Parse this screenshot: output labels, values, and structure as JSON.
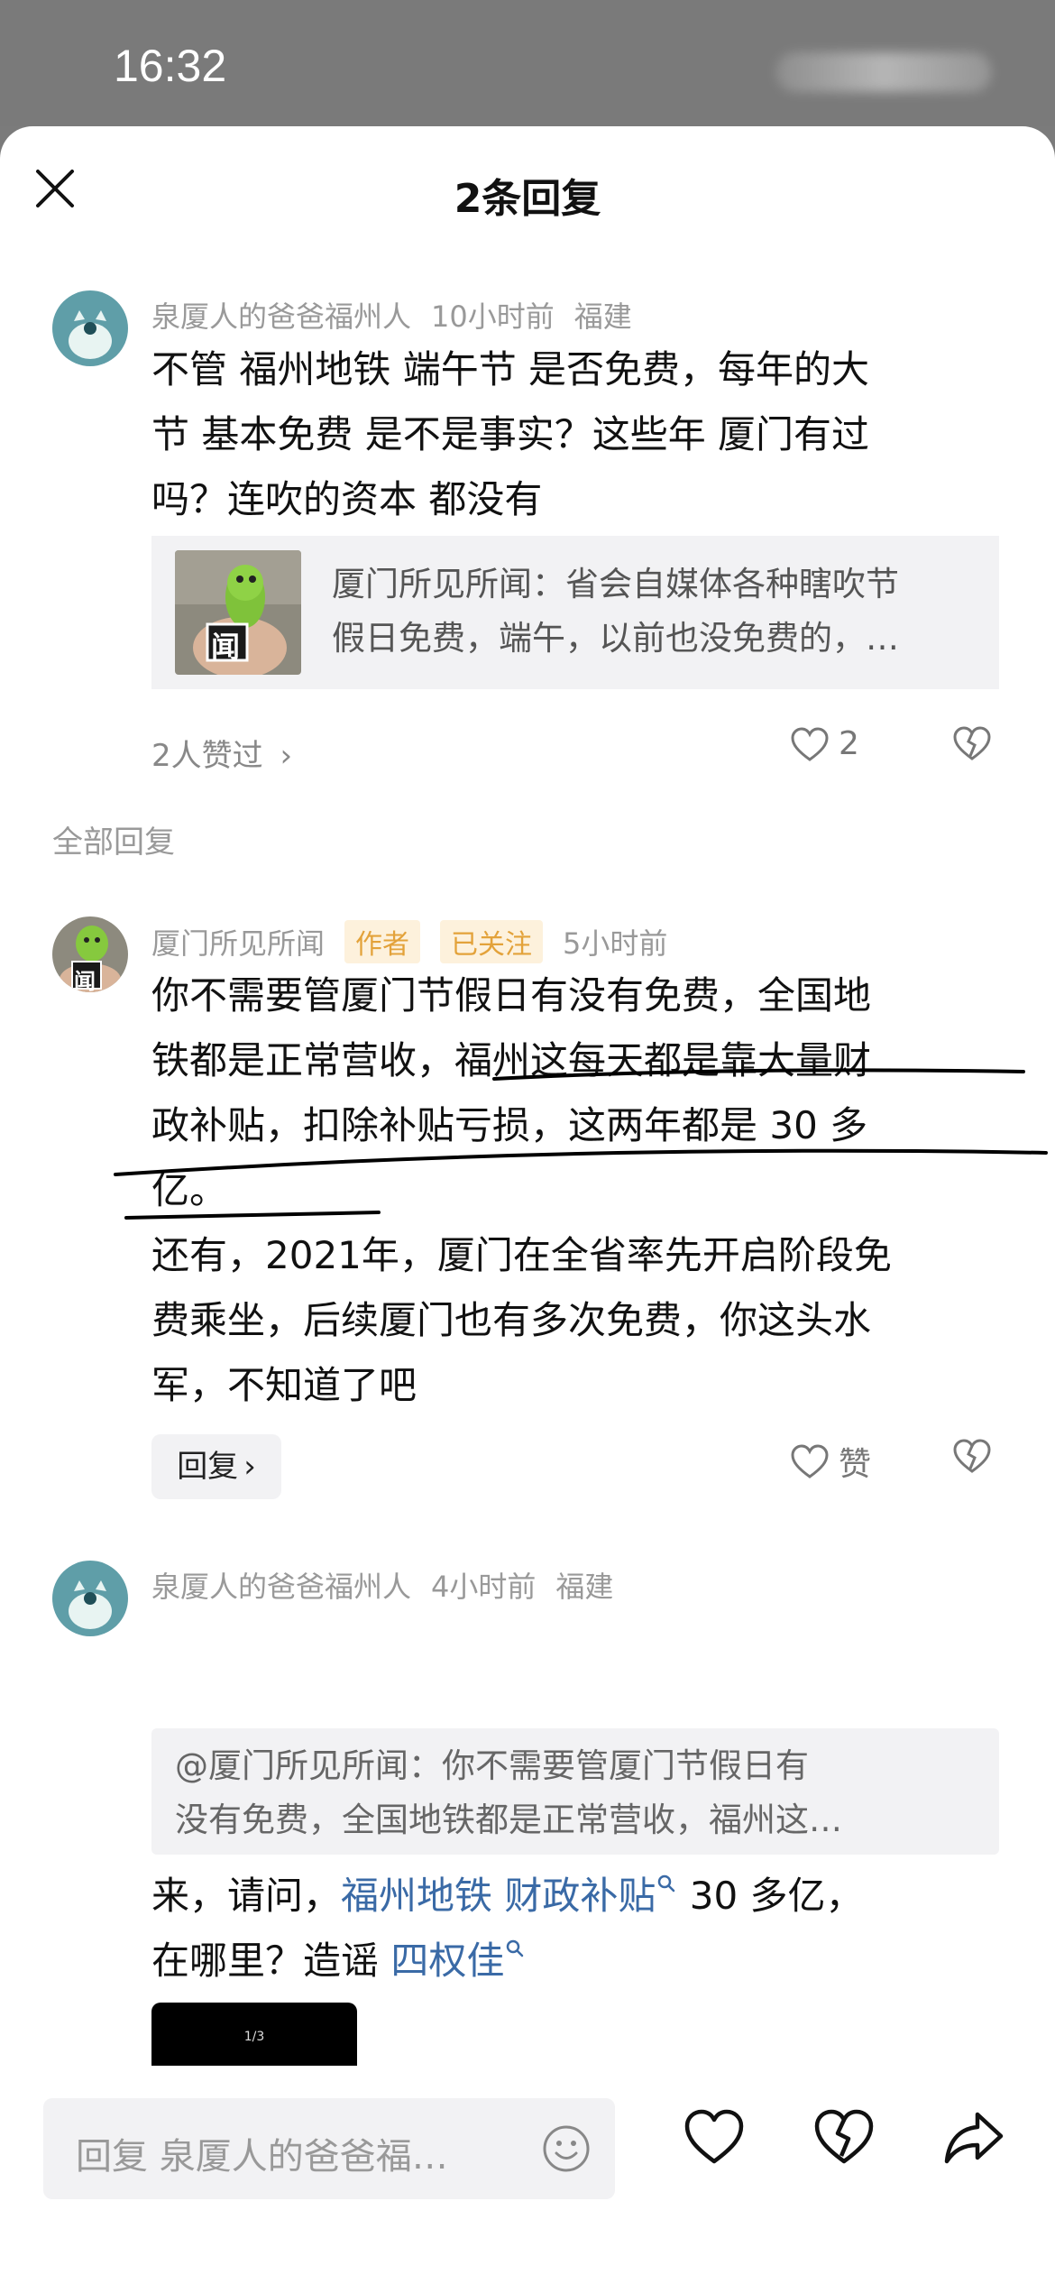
{
  "status_bar": {
    "time": "16:32"
  },
  "header": {
    "title": "2条回复"
  },
  "main_comment": {
    "author": "泉厦人的爸爸福州人",
    "time": "10小时前",
    "location": "福建",
    "text_lines": [
      "不管 福州地铁 端午节 是否免费，每年的大",
      "节 基本免费 是不是事实？这些年 厦门有过",
      "吗？连吹的资本 都没有"
    ],
    "quote": {
      "thumb_badge": "闻",
      "text_lines": [
        "厦门所见所闻：省会自媒体各种瞎吹节",
        "假日免费，端午，以前也没免费的，…"
      ]
    },
    "likes_link": "2人赞过",
    "like_count": "2"
  },
  "section_label": "全部回复",
  "reply1": {
    "author": "厦门所见所闻",
    "avatar_badge": "闻",
    "tag_author": "作者",
    "tag_following": "已关注",
    "time": "5小时前",
    "text_lines": [
      "你不需要管厦门节假日有没有免费，全国地",
      "铁都是正常营收，福州这每天都是靠大量财",
      "政补贴，扣除补贴亏损，这两年都是 30 多",
      "亿。",
      "还有，2021年，厦门在全省率先开启阶段免",
      "费乘坐，后续厦门也有多次免费，你这头水",
      "军，不知道了吧"
    ],
    "reply_label": "回复",
    "like_label": "赞"
  },
  "reply2": {
    "author": "泉厦人的爸爸福州人",
    "time": "4小时前",
    "location": "福建",
    "quote_lines": [
      "@厦门所见所闻：你不需要管厦门节假日有",
      "没有免费，全国地铁都是正常营收，福州这…"
    ],
    "line1_prefix": "来，请问，",
    "link1": "福州地铁 财政补贴",
    "line1_suffix": " 30 多亿，",
    "line2_prefix": "在哪里？造谣 ",
    "link2": "四权佳",
    "image_counter": "1/3"
  },
  "bottom_bar": {
    "placeholder": "回复 泉厦人的爸爸福…"
  },
  "colors": {
    "link": "#3a6aa6",
    "tag_bg": "#fdf1dc",
    "tag_text": "#e3a23a",
    "avatar_bg": "#5f9ea8"
  }
}
